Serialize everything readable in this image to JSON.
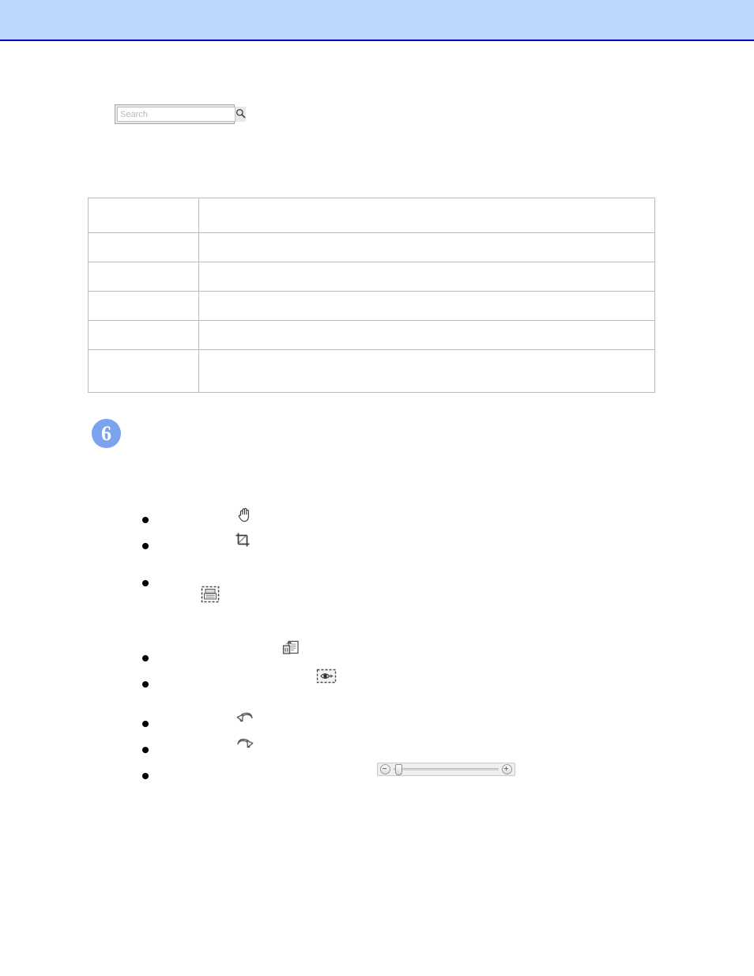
{
  "page": {
    "header_title": "",
    "footer_text": ""
  },
  "search": {
    "placeholder": "Search",
    "value": "",
    "button_icon": "search-icon"
  },
  "table": {
    "columns": [
      "",
      ""
    ],
    "rows": [
      {
        "label": "",
        "description": ""
      },
      {
        "label": "",
        "description": ""
      },
      {
        "label": "",
        "description": ""
      },
      {
        "label": "",
        "description": ""
      },
      {
        "label": "",
        "description": ""
      },
      {
        "label": "",
        "description": ""
      }
    ]
  },
  "step": {
    "number": "6",
    "badge_color": "#7ba3ee",
    "text": ""
  },
  "bullets": [
    {
      "text": "",
      "icon": "hand-pan-icon"
    },
    {
      "text": "",
      "icon": "crop-icon"
    },
    {
      "text": "",
      "icon": "scan-area-icon"
    },
    {
      "text": "",
      "icon": "document-export-icon"
    },
    {
      "text": "",
      "icon": "preview-eye-icon"
    },
    {
      "text": "",
      "icon": "undo-icon"
    },
    {
      "text": "",
      "icon": "redo-icon"
    },
    {
      "text": "",
      "icon": "zoom-slider-icon"
    }
  ],
  "zoom_slider": {
    "minus_label": "−",
    "plus_label": "+",
    "value": 3
  }
}
